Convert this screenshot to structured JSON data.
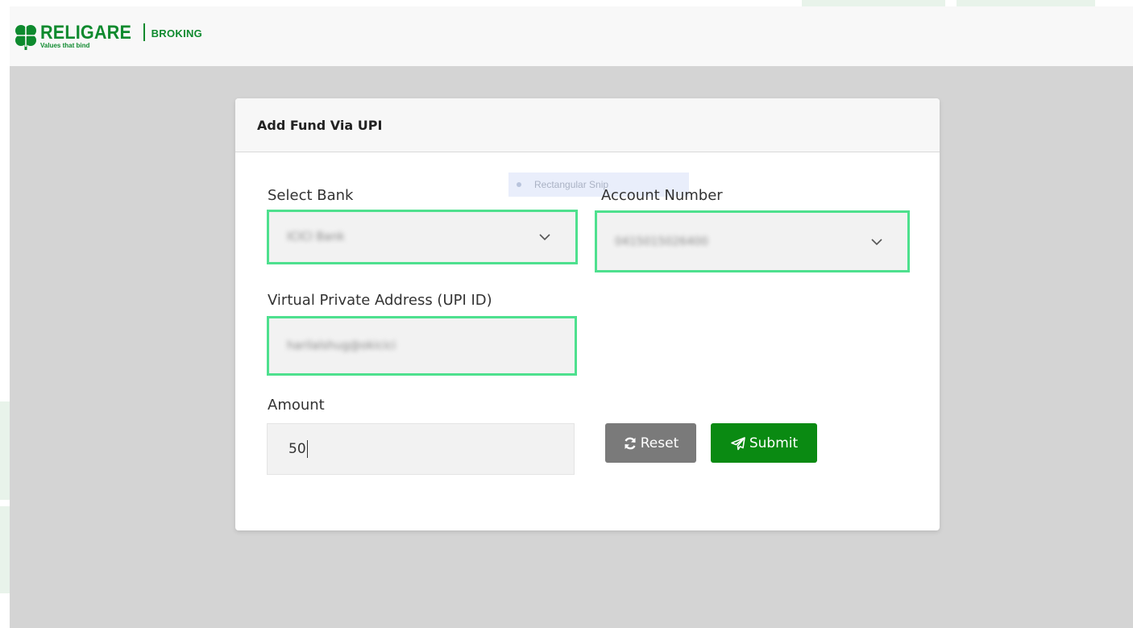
{
  "brand": {
    "name": "RELIGARE",
    "tagline": "Values that bind",
    "division": "BROKING",
    "color": "#0e8a2e"
  },
  "card": {
    "title": "Add Fund Via UPI"
  },
  "form": {
    "bank_label": "Select Bank",
    "bank_value": "ICICI Bank",
    "account_label": "Account Number",
    "account_value": "0415015026400",
    "upi_label": "Virtual Private Address (UPI ID)",
    "upi_value": "harilalshug@okicici",
    "amount_label": "Amount",
    "amount_value": "50"
  },
  "buttons": {
    "reset_label": "Reset",
    "reset_icon": "refresh-icon",
    "submit_label": "Submit",
    "submit_icon": "paper-plane-icon"
  },
  "overlay": {
    "snip_tooltip": "Rectangular Snip"
  },
  "colors": {
    "field_highlight": "#4ee08e",
    "submit_bg": "#0a8a12",
    "reset_bg": "#7a7a7a",
    "page_bg": "#d4d4d4"
  }
}
